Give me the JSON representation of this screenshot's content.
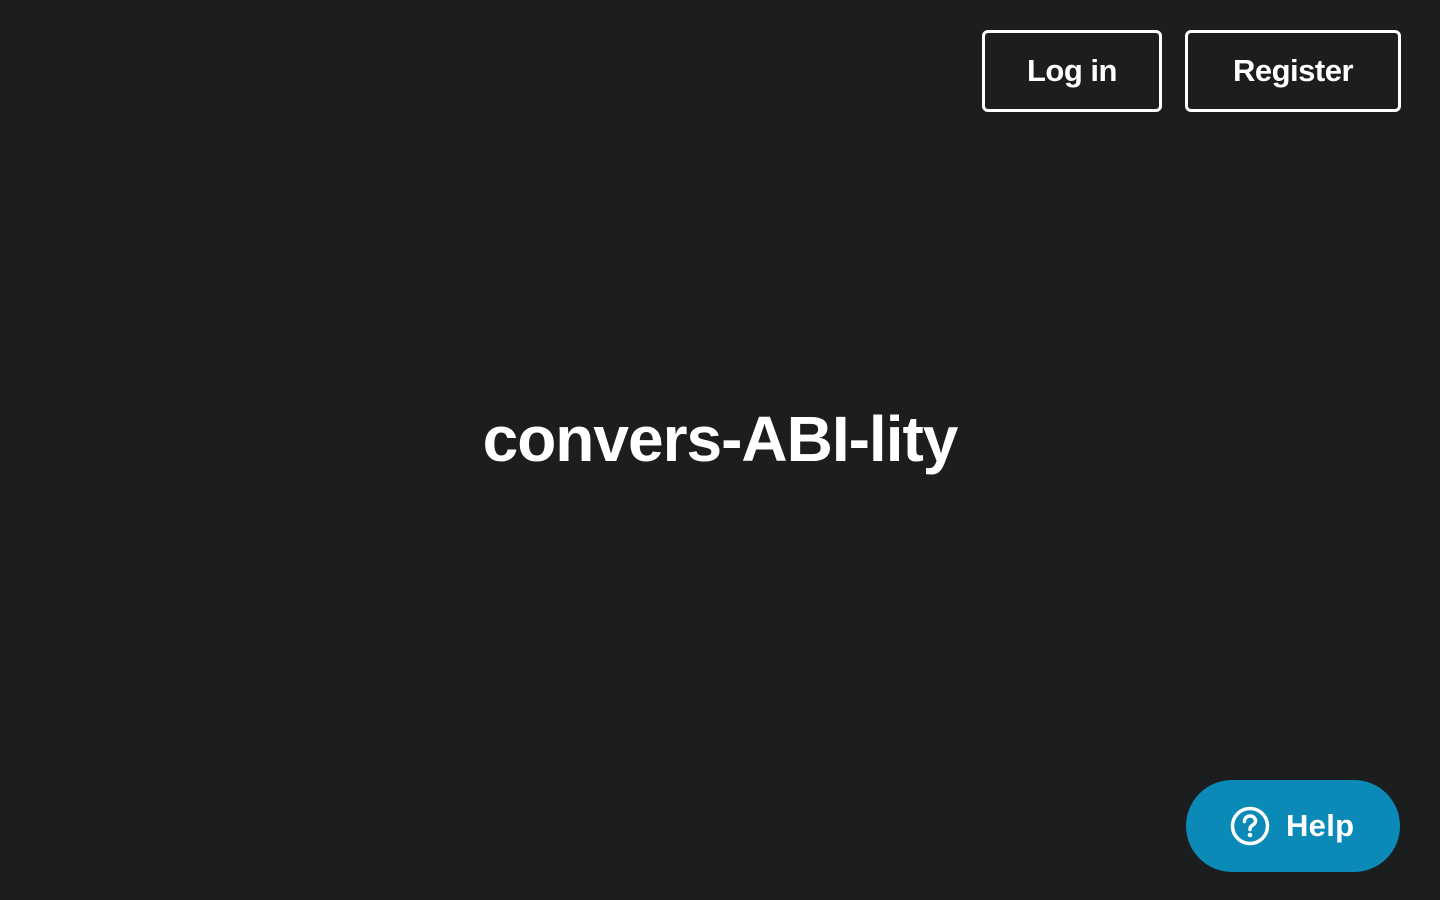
{
  "header": {
    "login_label": "Log in",
    "register_label": "Register"
  },
  "hero": {
    "title": "convers-ABI-lity"
  },
  "help": {
    "label": "Help",
    "icon": "question-circle-icon"
  },
  "colors": {
    "background": "#1c1d1f",
    "text": "#ffffff",
    "help_accent": "#0b8ab8"
  }
}
